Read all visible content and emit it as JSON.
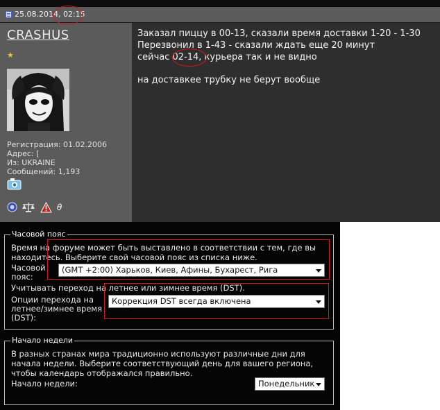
{
  "post": {
    "date": "25.08.2014, 02:15",
    "username": "CRASHUS",
    "rank_icon": "star-icon",
    "user_info": {
      "registration": "Регистрация: 01.02.2006",
      "address": "Адрес: [",
      "from": "Из: UKRAINE",
      "messages": "Сообщений: 1,193"
    },
    "badge_glyph": "θ",
    "message_lines": [
      "Заказал пиццу в 00-13, сказали время доставки 1-20 - 1-30",
      "Перезвонил в 1-43 - сказали ждать еще 20 минут",
      "сейчас 02-14, курьера так и не видно",
      "на доставкее трубку не берут вообще"
    ]
  },
  "timezone": {
    "legend": "Часовой пояс",
    "description_line1": "Время на форуме может быть выставлено в соответствии с тем, где вы",
    "description_line2": "находитесь. Выберите свой часовой пояс из списка ниже.",
    "label_line1": "Часовой",
    "label_line2": "пояс:",
    "selected": "(GMT +2:00) Харьков, Киев, Афины, Бухарест, Рига",
    "dst_note": "Учитывать переход на летнее или зимнее время (DST).",
    "dst_label_line1": "Опции перехода на",
    "dst_label_line2": "летнее/зимнее время",
    "dst_label_line3": "(DST):",
    "dst_selected": "Коррекция DST всегда включена"
  },
  "week": {
    "legend": "Начало недели",
    "description_line1": "В разных странах мира традиционно используют различные дни для",
    "description_line2": "начала недели. Выберите соответствующий день для вашего региона,",
    "description_line3": "чтобы календарь отображался правильно.",
    "label": "Начало недели:",
    "selected": "Понедельник"
  },
  "colors": {
    "annotation_red": "#d81818",
    "post_background": "#2e2e2e",
    "user_panel": "#5b5b5b",
    "settings_background": "#050505"
  }
}
